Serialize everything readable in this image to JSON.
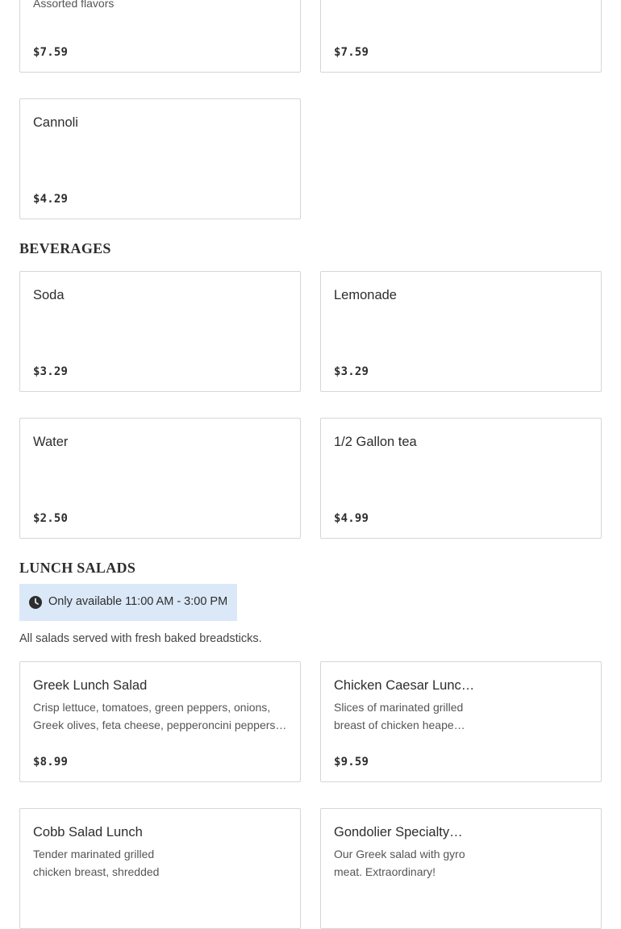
{
  "dessert_cards": [
    {
      "name": "",
      "desc": [
        "Assorted flavors"
      ],
      "price": "$7.59"
    },
    {
      "name": "",
      "desc": [],
      "price": "$7.59"
    },
    {
      "name": "Cannoli",
      "desc": [],
      "price": "$4.29"
    }
  ],
  "beverages": {
    "title": "BEVERAGES",
    "items": [
      {
        "name": "Soda",
        "price": "$3.29"
      },
      {
        "name": "Lemonade",
        "price": "$3.29"
      },
      {
        "name": "Water",
        "price": "$2.50"
      },
      {
        "name": "1/2 Gallon tea",
        "price": "$4.99"
      }
    ]
  },
  "lunch_salads": {
    "title": "LUNCH SALADS",
    "availability": "Only available 11:00 AM - 3:00 PM",
    "note": "All salads served with fresh baked breadsticks.",
    "items": [
      {
        "name": "Greek Lunch Salad",
        "desc": [
          "Crisp lettuce, tomatoes, green peppers, onions,",
          "Greek olives, feta cheese, pepperoncini peppers…"
        ],
        "price": "$8.99"
      },
      {
        "name": "Chicken Caesar Lunc…",
        "desc": [
          "Slices of marinated grilled",
          "breast of chicken heape…"
        ],
        "price": "$9.59"
      },
      {
        "name": "Cobb Salad Lunch",
        "desc": [
          "Tender marinated grilled",
          "chicken breast, shredded"
        ],
        "price": ""
      },
      {
        "name": "Gondolier Specialty…",
        "desc": [
          "Our Greek salad with gyro",
          "meat. Extraordinary!"
        ],
        "price": ""
      }
    ]
  },
  "colors": {
    "border": "#d6d6d6",
    "availability_bg": "#dbe8f8",
    "text": "#2d2d2d"
  },
  "icons": {
    "availability": "clock-icon"
  }
}
